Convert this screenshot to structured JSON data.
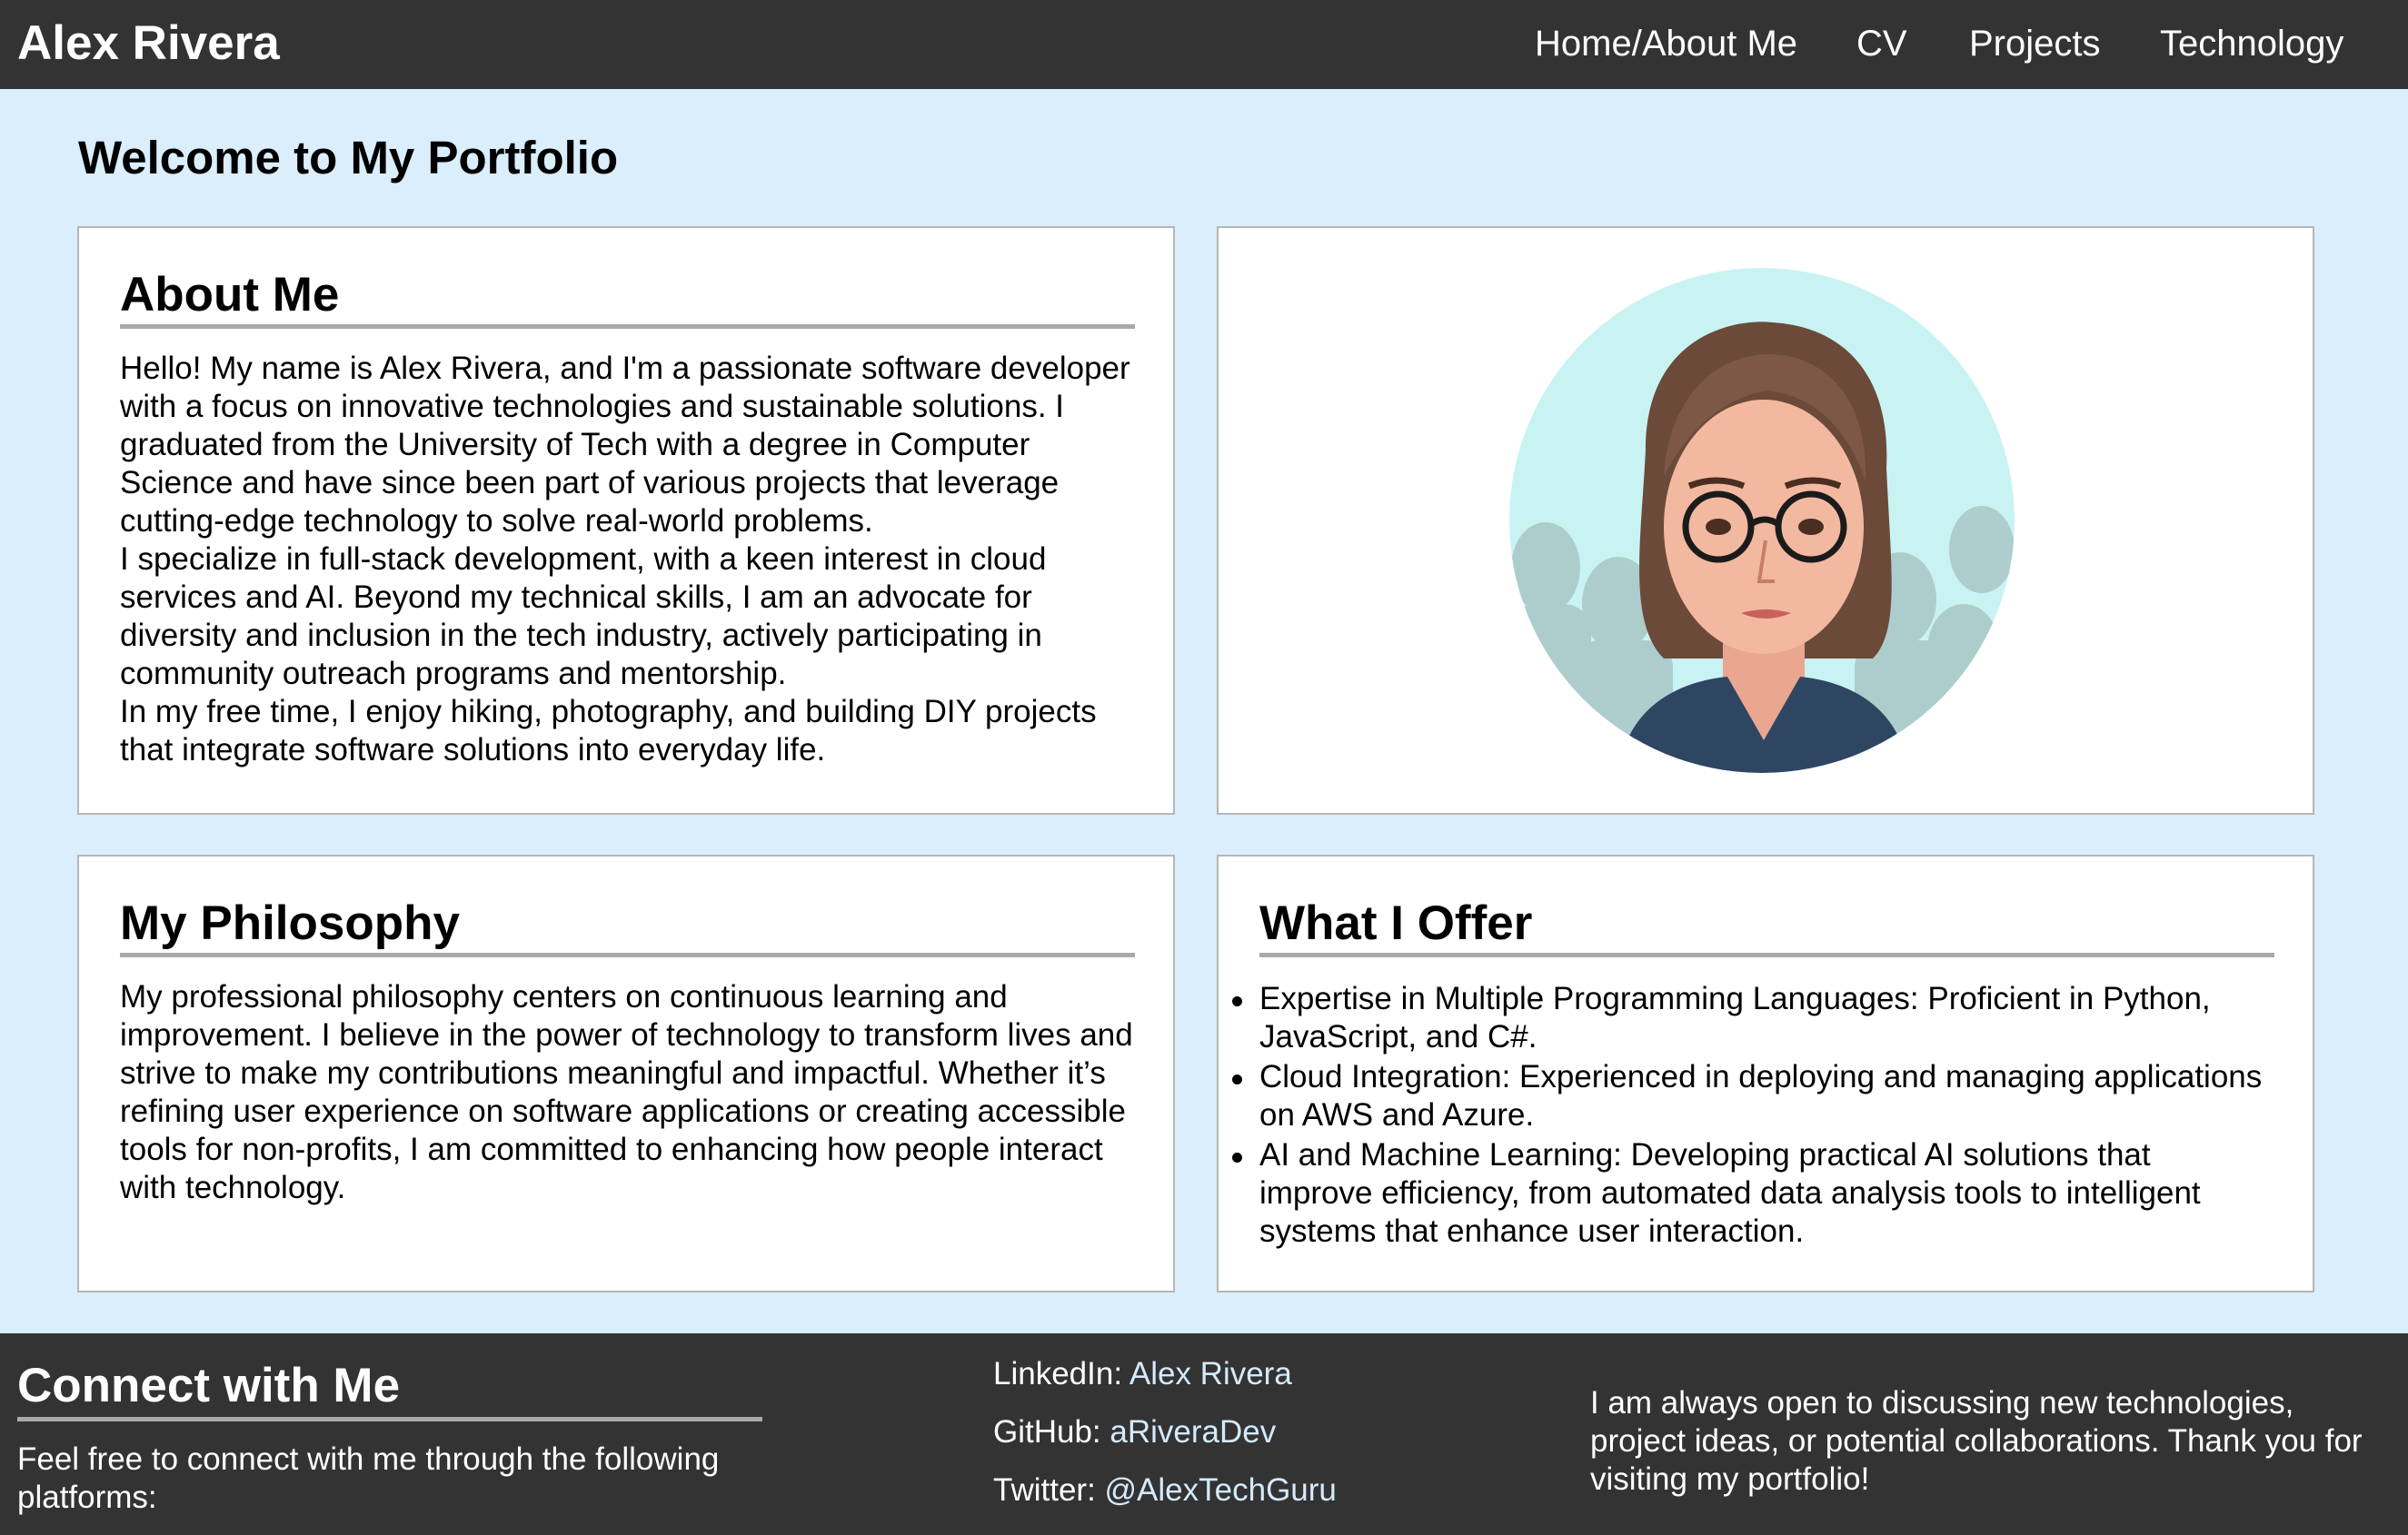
{
  "header": {
    "brand": "Alex Rivera",
    "nav": [
      "Home/About Me",
      "CV",
      "Projects",
      "Technology"
    ]
  },
  "main": {
    "page_title": "Welcome to My Portfolio",
    "about": {
      "heading": "About Me",
      "paragraphs": [
        "Hello! My name is Alex Rivera, and I'm a passionate software developer with a focus on innovative technologies and sustainable solutions. I graduated from the University of Tech with a degree in Computer Science and have since been part of various projects that leverage cutting-edge technology to solve real-world problems.",
        "I specialize in full-stack development, with a keen interest in cloud services and AI. Beyond my technical skills, I am an advocate for diversity and inclusion in the tech industry, actively participating in community outreach programs and mentorship.",
        "In my free time, I enjoy hiking, photography, and building DIY projects that integrate software solutions into everyday life."
      ]
    },
    "philosophy": {
      "heading": "My Philosophy",
      "text": "My professional philosophy centers on continuous learning and improvement. I believe in the power of technology to transform lives and strive to make my contributions meaningful and impactful. Whether it’s refining user experience on software applications or creating accessible tools for non-profits, I am committed to enhancing how people interact with technology."
    },
    "offer": {
      "heading": "What I Offer",
      "items": [
        "Expertise in Multiple Programming Languages: Proficient in Python, JavaScript, and C#.",
        "Cloud Integration: Experienced in deploying and managing applications on AWS and Azure.",
        "AI and Machine Learning: Developing practical AI solutions that improve efficiency, from automated data analysis tools to intelligent systems that enhance user interaction."
      ]
    }
  },
  "footer": {
    "heading": "Connect with Me",
    "intro": "Feel free to connect with me through the following platforms:",
    "social": [
      {
        "label": "LinkedIn:",
        "link": "Alex Rivera"
      },
      {
        "label": "GitHub:",
        "link": "aRiveraDev"
      },
      {
        "label": "Twitter:",
        "link": "@AlexTechGuru"
      }
    ],
    "closing": "I am always open to discussing new technologies, project ideas, or potential collaborations. Thank you for visiting my portfolio!"
  },
  "colors": {
    "header_bg": "#333333",
    "page_bg": "#dbeefc",
    "link": "#d4eafc",
    "rule": "#a9a9a9"
  }
}
